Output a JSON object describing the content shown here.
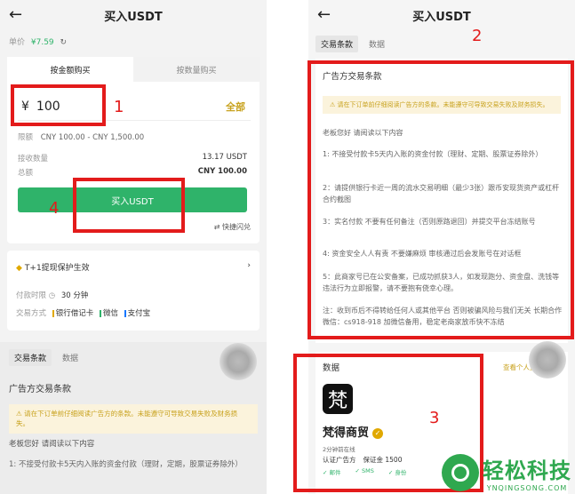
{
  "left": {
    "header": {
      "back_icon": "arrow-left-icon",
      "title": "买入USDT"
    },
    "price": {
      "label": "单价",
      "value": "¥7.59",
      "refresh_icon": "refresh-icon"
    },
    "tabs": [
      "按金额购买",
      "按数量购买"
    ],
    "amount": {
      "currency": "¥",
      "value": "100",
      "all_label": "全部"
    },
    "limit": {
      "label": "限额",
      "value": "CNY 100.00 - CNY 1,500.00"
    },
    "receive": {
      "label": "接收数量",
      "value": "13.17 USDT"
    },
    "total": {
      "label": "总额",
      "value": "CNY 100.00"
    },
    "buy_button": "买入USDT",
    "quick_flash": "快捷闪兑",
    "protection": "T+1提现保护生效",
    "pay_term": {
      "label": "付款时限",
      "value": "30 分钟"
    },
    "pay_methods": {
      "label": "交易方式",
      "items": [
        "银行借记卡",
        "微信",
        "支付宝"
      ]
    },
    "terms_tabs": [
      "交易条款",
      "数据"
    ],
    "ad_terms_title": "广告方交易条款",
    "warning": "请在下订单前仔细阅读广告方的条款。未能遵守可导致交易失败及财务损失。",
    "greeting": "老板您好 请阅读以下内容",
    "rule1": "1:  不接受付款卡5天内入账的资金付款（理财，定期，股票证券除外）"
  },
  "right": {
    "header": {
      "back_icon": "arrow-left-icon",
      "title": "买入USDT"
    },
    "tabs": [
      "交易条款",
      "数据"
    ],
    "ad_terms_title": "广告方交易条款",
    "warning": "请在下订单前仔细阅读广告方的条款。未能遵守可导致交易失败及财务损失。",
    "greeting": "老板您好 请阅读以下内容",
    "rules": [
      "1:  不接受付款卡5天内入账的资金付款（理财、定期、股票证券除外）",
      "2：请提供银行卡近一周的流水交易明细（最少3张）跟币安现货资产或杠杆合约截图",
      "3：实名付款 不要有任何备注（否则原路退回）并提交平台冻结账号",
      "4:  资金安全人人有责 不要嫌麻烦 审核通过后会发账号在对话框",
      "5：此商家号已在公安备案，已成功抓获3人，如发现跑分、资金盘、洗钱等违法行为立即报警，请不要抱有侥幸心理。",
      "注：收到币后不得转给任何人或其他平台 否则被骗风险与我们无关 长期合作微信：cs918-918 加微信备用，稳定老商家放币快不冻结"
    ],
    "data_title": "数据",
    "more_link": "查看个人资料",
    "merchant_logo": "梵",
    "merchant_name": "梵得商贸",
    "online": "2分钟前在线",
    "badges": [
      "认证广告方",
      "保证金 1500"
    ],
    "checks": [
      "邮件",
      "SMS",
      "身份"
    ]
  },
  "annotations": [
    "1",
    "2",
    "3",
    "4"
  ],
  "watermark": {
    "main": "轻松科技",
    "sub": "YNQINGSONG.COM"
  }
}
